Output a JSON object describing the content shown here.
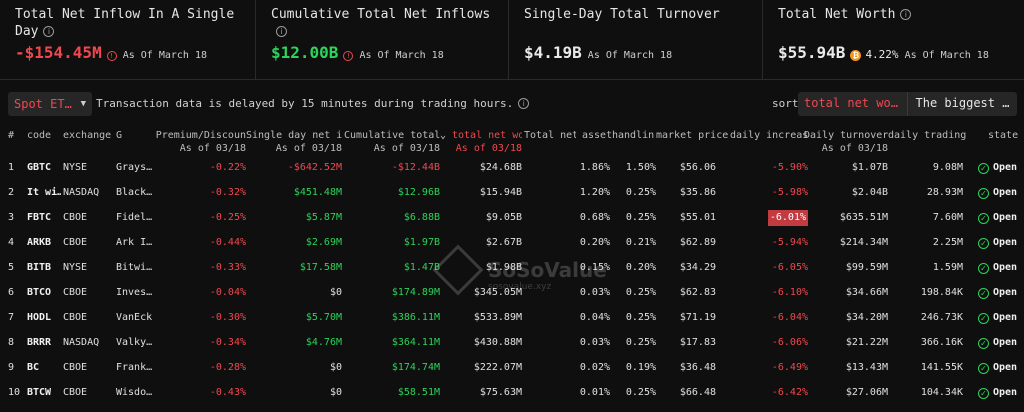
{
  "cards": [
    {
      "title": "Total Net Inflow In A Single Day",
      "value": "-$154.45M",
      "value_color": "#f0484f",
      "asof": "As Of March 18",
      "badge": "warn"
    },
    {
      "title": "Cumulative Total Net Inflows",
      "value": "$12.00B",
      "value_color": "#2bd45a",
      "asof": "As Of March 18",
      "badge": "warn"
    },
    {
      "title": "Single-Day Total Turnover",
      "value": "$4.19B",
      "value_color": "#eaeaea",
      "asof": "As Of March 18",
      "badge": "none"
    },
    {
      "title": "Total Net Worth",
      "value": "$55.94B",
      "value_color": "#eaeaea",
      "asof": "As Of March 18",
      "badge": "btc",
      "btc_pct": "4.22%"
    }
  ],
  "toolbar": {
    "spot_select": "Spot ET…",
    "delay_note": "Transaction data is delayed by 15 minutes during trading hours.",
    "sort_label": "sort",
    "sort_field": "total net wo…",
    "sort_order": "The biggest …"
  },
  "table": {
    "headers": {
      "num": "#",
      "code": "code",
      "exchange": "exchange",
      "g": "G",
      "premium": "Premium/Discoun",
      "premium_sub": "As of 03/18",
      "single_day": "Single day net i",
      "single_day_sub": "As of 03/18",
      "cumulative": "Cumulative total",
      "cumulative_sub": "As of 03/18",
      "net_worth": "total net wo",
      "net_worth_sub": "As of 03/18",
      "total_net": "Total net",
      "asset": "asset",
      "handling": "handlin",
      "market_price": "market price",
      "daily_increase": "daily increas",
      "turnover": "Daily turnover",
      "turnover_sub": "As of 03/18",
      "trading": "daily trading",
      "state": "state"
    },
    "rows": [
      {
        "num": "1",
        "code": "GBTC",
        "exchange": "NYSE",
        "issuer": "Grays…",
        "premium": "-0.22%",
        "single_day": "-$642.52M",
        "cumulative": "-$12.44B",
        "net_worth": "$24.68B",
        "asset": "1.86%",
        "handling": "1.50%",
        "market_price": "$56.06",
        "daily_increase": "-5.90%",
        "turnover": "$1.07B",
        "trading": "9.08M",
        "state": "Open"
      },
      {
        "num": "2",
        "code": "It wi…",
        "exchange": "NASDAQ",
        "issuer": "Black…",
        "premium": "-0.32%",
        "single_day": "$451.48M",
        "cumulative": "$12.96B",
        "net_worth": "$15.94B",
        "asset": "1.20%",
        "handling": "0.25%",
        "market_price": "$35.86",
        "daily_increase": "-5.98%",
        "turnover": "$2.04B",
        "trading": "28.93M",
        "state": "Open"
      },
      {
        "num": "3",
        "code": "FBTC",
        "exchange": "CBOE",
        "issuer": "Fidel…",
        "premium": "-0.25%",
        "single_day": "$5.87M",
        "cumulative": "$6.88B",
        "net_worth": "$9.05B",
        "asset": "0.68%",
        "handling": "0.25%",
        "market_price": "$55.01",
        "daily_increase": "-6.01%",
        "turnover": "$635.51M",
        "trading": "7.60M",
        "state": "Open"
      },
      {
        "num": "4",
        "code": "ARKB",
        "exchange": "CBOE",
        "issuer": "Ark I…",
        "premium": "-0.44%",
        "single_day": "$2.69M",
        "cumulative": "$1.97B",
        "net_worth": "$2.67B",
        "asset": "0.20%",
        "handling": "0.21%",
        "market_price": "$62.89",
        "daily_increase": "-5.94%",
        "turnover": "$214.34M",
        "trading": "2.25M",
        "state": "Open"
      },
      {
        "num": "5",
        "code": "BITB",
        "exchange": "NYSE",
        "issuer": "Bitwi…",
        "premium": "-0.33%",
        "single_day": "$17.58M",
        "cumulative": "$1.47B",
        "net_worth": "$1.98B",
        "asset": "0.15%",
        "handling": "0.20%",
        "market_price": "$34.29",
        "daily_increase": "-6.05%",
        "turnover": "$99.59M",
        "trading": "1.59M",
        "state": "Open"
      },
      {
        "num": "6",
        "code": "BTCO",
        "exchange": "CBOE",
        "issuer": "Inves…",
        "premium": "-0.04%",
        "single_day": "$0",
        "cumulative": "$174.89M",
        "net_worth": "$345.05M",
        "asset": "0.03%",
        "handling": "0.25%",
        "market_price": "$62.83",
        "daily_increase": "-6.10%",
        "turnover": "$34.66M",
        "trading": "198.84K",
        "state": "Open"
      },
      {
        "num": "7",
        "code": "HODL",
        "exchange": "CBOE",
        "issuer": "VanEck",
        "premium": "-0.30%",
        "single_day": "$5.70M",
        "cumulative": "$386.11M",
        "net_worth": "$533.89M",
        "asset": "0.04%",
        "handling": "0.25%",
        "market_price": "$71.19",
        "daily_increase": "-6.04%",
        "turnover": "$34.20M",
        "trading": "246.73K",
        "state": "Open"
      },
      {
        "num": "8",
        "code": "BRRR",
        "exchange": "NASDAQ",
        "issuer": "Valky…",
        "premium": "-0.34%",
        "single_day": "$4.76M",
        "cumulative": "$364.11M",
        "net_worth": "$430.88M",
        "asset": "0.03%",
        "handling": "0.25%",
        "market_price": "$17.83",
        "daily_increase": "-6.06%",
        "turnover": "$21.22M",
        "trading": "366.16K",
        "state": "Open"
      },
      {
        "num": "9",
        "code": "BC",
        "exchange": "CBOE",
        "issuer": "Frank…",
        "premium": "-0.28%",
        "single_day": "$0",
        "cumulative": "$174.74M",
        "net_worth": "$222.07M",
        "asset": "0.02%",
        "handling": "0.19%",
        "market_price": "$36.48",
        "daily_increase": "-6.49%",
        "turnover": "$13.43M",
        "trading": "141.55K",
        "state": "Open"
      },
      {
        "num": "10",
        "code": "BTCW",
        "exchange": "CBOE",
        "issuer": "Wisdo…",
        "premium": "-0.43%",
        "single_day": "$0",
        "cumulative": "$58.51M",
        "net_worth": "$75.63M",
        "asset": "0.01%",
        "handling": "0.25%",
        "market_price": "$66.48",
        "daily_increase": "-6.42%",
        "turnover": "$27.06M",
        "trading": "104.34K",
        "state": "Open"
      }
    ]
  },
  "watermark": {
    "name": "SoSoValue",
    "site": "sosovalue.xyz"
  },
  "colors": {
    "negative": "#f0484f",
    "positive": "#2bd45a",
    "highlight": "#c23b40",
    "background": "#0f0f0f"
  }
}
